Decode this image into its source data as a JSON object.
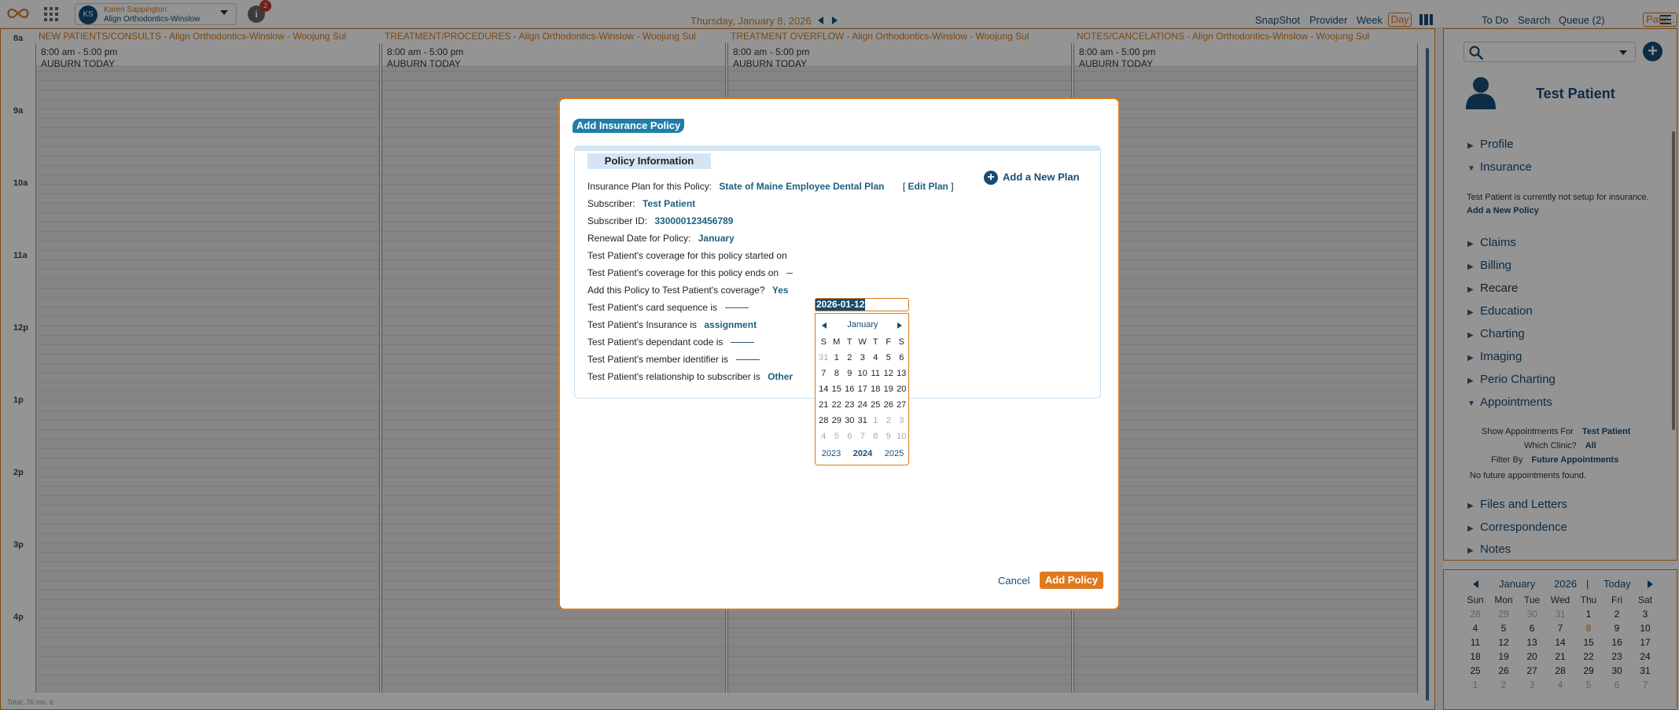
{
  "topbar": {
    "user_initials": "KS",
    "user_name": "Karen Sappington",
    "user_clinic": "Align Orthodontics-Winslow",
    "notification_count": "2",
    "info_icon": "i",
    "date": "Thursday, January 8, 2026",
    "nav": {
      "snapshot": "SnapShot",
      "provider": "Provider",
      "week": "Week",
      "day": "Day",
      "todo": "To Do",
      "search": "Search",
      "queue": "Queue (2)",
      "patient": "Patie..."
    }
  },
  "schedule": {
    "time_labels": [
      "8a",
      "9a",
      "10a",
      "11a",
      "12p",
      "1p",
      "2p",
      "3p",
      "4p"
    ],
    "columns": [
      {
        "title": "NEW PATIENTS/CONSULTS - Align Orthodontics-Winslow - Woojung Sul",
        "hours": "8:00 am - 5:00 pm",
        "note": "AUBURN TODAY"
      },
      {
        "title": "TREATMENT/PROCEDURES - Align Orthodontics-Winslow - Woojung Sul",
        "hours": "8:00 am - 5:00 pm",
        "note": "AUBURN TODAY"
      },
      {
        "title": "TREATMENT OVERFLOW - Align Orthodontics-Winslow - Woojung Sul",
        "hours": "8:00 am - 5:00 pm",
        "note": "AUBURN TODAY"
      },
      {
        "title": "NOTES/CANCELATIONS - Align Orthodontics-Winslow - Woojung Sul",
        "hours": "8:00 am - 5:00 pm",
        "note": "AUBURN TODAY"
      }
    ],
    "footer_total": "Total: 76 mo. 6"
  },
  "modal": {
    "title": "Add Insurance Policy",
    "section_tab": "Policy Information",
    "add_new_plan": "Add a New Plan",
    "plan_label": "Insurance Plan for this Policy:",
    "plan_value": "State of Maine Employee Dental Plan",
    "edit_plan_open": "[",
    "edit_plan": "Edit Plan",
    "edit_plan_close": "]",
    "subscriber_label": "Subscriber:",
    "subscriber_value": "Test Patient",
    "subscriber_id_label": "Subscriber ID:",
    "subscriber_id_value": "330000123456789",
    "renewal_label": "Renewal Date for Policy:",
    "renewal_value": "January",
    "started_label": "Test Patient's coverage for this policy started on",
    "started_value": "2026-01-12",
    "ends_label": "Test Patient's coverage for this policy ends on",
    "add_label": "Add this Policy to Test Patient's coverage?",
    "add_value": "Yes",
    "card_seq_label": "Test Patient's card sequence is",
    "insurance_label": "Test Patient's Insurance is",
    "insurance_value": "assignment",
    "dependant_label": "Test Patient's dependant code is",
    "member_label": "Test Patient's member identifier is",
    "relationship_label": "Test Patient's relationship to subscriber is",
    "relationship_value": "Other",
    "cancel": "Cancel",
    "add_policy": "Add Policy"
  },
  "datepicker": {
    "month": "January",
    "weekdays": [
      "S",
      "M",
      "T",
      "W",
      "T",
      "F",
      "S"
    ],
    "days": [
      {
        "d": "31",
        "m": true
      },
      {
        "d": "1"
      },
      {
        "d": "2"
      },
      {
        "d": "3"
      },
      {
        "d": "4"
      },
      {
        "d": "5"
      },
      {
        "d": "6"
      },
      {
        "d": "7"
      },
      {
        "d": "8"
      },
      {
        "d": "9"
      },
      {
        "d": "10"
      },
      {
        "d": "11"
      },
      {
        "d": "12"
      },
      {
        "d": "13"
      },
      {
        "d": "14"
      },
      {
        "d": "15"
      },
      {
        "d": "16"
      },
      {
        "d": "17"
      },
      {
        "d": "18"
      },
      {
        "d": "19"
      },
      {
        "d": "20"
      },
      {
        "d": "21"
      },
      {
        "d": "22"
      },
      {
        "d": "23"
      },
      {
        "d": "24"
      },
      {
        "d": "25"
      },
      {
        "d": "26"
      },
      {
        "d": "27"
      },
      {
        "d": "28"
      },
      {
        "d": "29"
      },
      {
        "d": "30"
      },
      {
        "d": "31"
      },
      {
        "d": "1",
        "m": true
      },
      {
        "d": "2",
        "m": true
      },
      {
        "d": "3",
        "m": true
      },
      {
        "d": "4",
        "m": true
      },
      {
        "d": "5",
        "m": true
      },
      {
        "d": "6",
        "m": true
      },
      {
        "d": "7",
        "m": true
      },
      {
        "d": "8",
        "m": true
      },
      {
        "d": "9",
        "m": true
      },
      {
        "d": "10",
        "m": true
      }
    ],
    "years": [
      "2023",
      "2024",
      "2025"
    ]
  },
  "right_panel": {
    "patient_name": "Test Patient",
    "items_top": [
      {
        "label": "Profile",
        "expanded": false
      },
      {
        "label": "Insurance",
        "expanded": true
      }
    ],
    "insurance_note": "Test Patient is currently not setup for insurance.",
    "insurance_link": "Add a New Policy",
    "items_mid": [
      {
        "label": "Claims"
      },
      {
        "label": "Billing"
      },
      {
        "label": "Recare",
        "dark": true
      },
      {
        "label": "Education"
      },
      {
        "label": "Charting"
      },
      {
        "label": "Imaging"
      },
      {
        "label": "Perio Charting"
      },
      {
        "label": "Appointments",
        "expanded": true
      }
    ],
    "appts": {
      "show_label": "Show Appointments For",
      "show_value": "Test Patient",
      "clinic_label": "Which Clinic?",
      "clinic_value": "All",
      "filter_label": "Filter By",
      "filter_value": "Future Appointments",
      "none": "No future appointments found."
    },
    "items_bottom": [
      {
        "label": "Files and Letters"
      },
      {
        "label": "Correspondence"
      },
      {
        "label": "Notes"
      }
    ]
  },
  "mini_calendar": {
    "month": "January",
    "year": "2026",
    "separator": "|",
    "today": "Today",
    "weekdays": [
      "Sun",
      "Mon",
      "Tue",
      "Wed",
      "Thu",
      "Fri",
      "Sat"
    ],
    "days": [
      {
        "d": "28",
        "m": true
      },
      {
        "d": "29",
        "m": true
      },
      {
        "d": "30",
        "m": true
      },
      {
        "d": "31",
        "m": true
      },
      {
        "d": "1"
      },
      {
        "d": "2"
      },
      {
        "d": "3"
      },
      {
        "d": "4"
      },
      {
        "d": "5"
      },
      {
        "d": "6"
      },
      {
        "d": "7"
      },
      {
        "d": "8",
        "t": true
      },
      {
        "d": "9"
      },
      {
        "d": "10"
      },
      {
        "d": "11"
      },
      {
        "d": "12"
      },
      {
        "d": "13"
      },
      {
        "d": "14"
      },
      {
        "d": "15"
      },
      {
        "d": "16"
      },
      {
        "d": "17"
      },
      {
        "d": "18"
      },
      {
        "d": "19"
      },
      {
        "d": "20"
      },
      {
        "d": "21"
      },
      {
        "d": "22"
      },
      {
        "d": "23"
      },
      {
        "d": "24"
      },
      {
        "d": "25"
      },
      {
        "d": "26"
      },
      {
        "d": "27"
      },
      {
        "d": "28"
      },
      {
        "d": "29"
      },
      {
        "d": "30"
      },
      {
        "d": "31"
      },
      {
        "d": "1",
        "m": true
      },
      {
        "d": "2",
        "m": true
      },
      {
        "d": "3",
        "m": true
      },
      {
        "d": "4",
        "m": true
      },
      {
        "d": "5",
        "m": true
      },
      {
        "d": "6",
        "m": true
      },
      {
        "d": "7",
        "m": true
      }
    ]
  },
  "colors": {
    "accent": "#d97a1a",
    "brand": "#174c77",
    "title_badge": "#1e7fa8",
    "button": "#e07a1f"
  }
}
